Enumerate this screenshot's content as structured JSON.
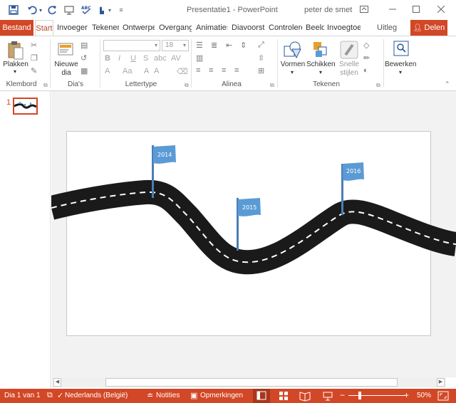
{
  "titlebar": {
    "title": "Presentatie1  -  PowerPoint",
    "user": "peter de smet",
    "icons": [
      "save-icon",
      "undo-icon",
      "redo-icon",
      "present-icon",
      "spelling-icon",
      "touch-mode-icon",
      "customize-icon"
    ]
  },
  "tabs": {
    "file": "Bestand",
    "items": [
      "Start",
      "Invoegen",
      "Tekenen",
      "Ontwerpen",
      "Overgangen",
      "Animaties",
      "Diavoorstelling",
      "Controleren",
      "Beeld",
      "Invoegtoepassingen"
    ],
    "tell_me": "Uitleg",
    "share": "Delen"
  },
  "ribbon": {
    "clipboard": {
      "paste": "Plakken",
      "label": "Klembord"
    },
    "slides": {
      "new_line1": "Nieuwe",
      "new_line2": "dia",
      "label": "Dia's"
    },
    "font": {
      "size": "18",
      "label": "Lettertype"
    },
    "paragraph": {
      "label": "Alinea"
    },
    "drawing": {
      "shapes": "Vormen",
      "arrange": "Schikken",
      "quick1": "Snelle",
      "quick2": "stijlen",
      "label": "Tekenen"
    },
    "editing": {
      "label": "Bewerken"
    }
  },
  "thumbnails": {
    "number": "1"
  },
  "slide": {
    "flags": [
      "2014",
      "2015",
      "2016"
    ],
    "colors": {
      "flag": "#5b9bd5",
      "road": "#1a1a1a",
      "dash": "#ffffff"
    }
  },
  "statusbar": {
    "slide_info": "Dia 1 van 1",
    "language": "Nederlands (België)",
    "notes": "Notities",
    "comments": "Opmerkingen",
    "zoom": "50%"
  },
  "theme": {
    "accent": "#d24726",
    "brand_blue": "#2b579a"
  }
}
